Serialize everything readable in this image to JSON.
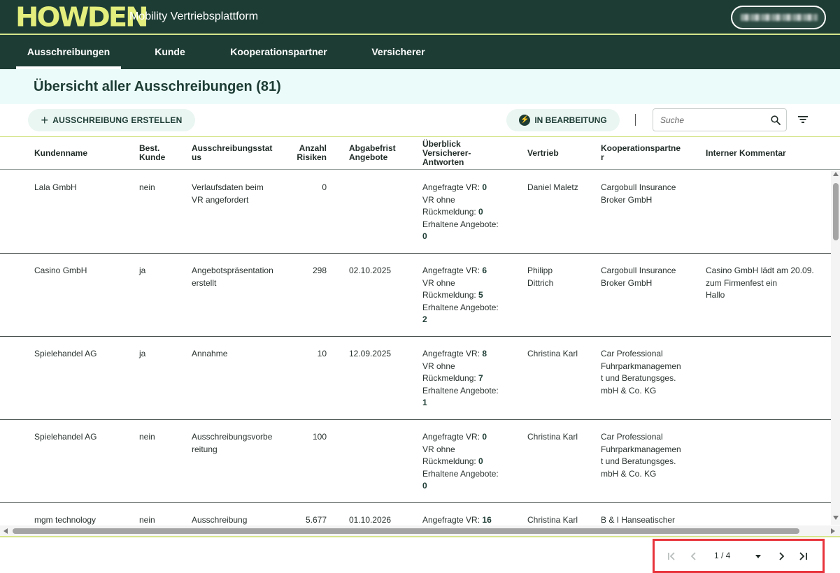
{
  "header": {
    "logo_text": "HOWDEN",
    "app_title": "Mobility Vertriebsplattform",
    "user_name": ""
  },
  "nav": {
    "items": [
      {
        "label": "Ausschreibungen",
        "active": true
      },
      {
        "label": "Kunde"
      },
      {
        "label": "Kooperationspartner"
      },
      {
        "label": "Versicherer"
      }
    ]
  },
  "page": {
    "title": "Übersicht aller Ausschreibungen (81)"
  },
  "toolbar": {
    "create_label": "AUSSCHREIBUNG ERSTELLEN",
    "status_label": "IN BEARBEITUNG",
    "search_placeholder": "Suche",
    "search_value": ""
  },
  "table": {
    "columns": [
      "Kundenname",
      "Best.\nKunde",
      "Ausschreibungsstat\nus",
      "Anzahl\nRisiken",
      "Abgabefrist\nAngebote",
      "Überblick\nVersicherer-\nAntworten",
      "Vertrieb",
      "Kooperationspartne\nr",
      "Interner Kommentar"
    ],
    "overview_labels": {
      "requested": "Angefragte VR:",
      "no_reply_1": "VR ohne",
      "no_reply_2": "Rückmeldung:",
      "offers": "Erhaltene Angebote:"
    },
    "rows": [
      {
        "kunde": "Lala GmbH",
        "best": "nein",
        "status": "Verlaufsdaten beim\nVR angefordert",
        "risiken": "0",
        "frist": "",
        "requested": "0",
        "no_reply": "0",
        "offers": "0",
        "vertrieb": "Daniel Maletz",
        "partner": "Cargobull Insurance\nBroker GmbH",
        "kommentar": ""
      },
      {
        "kunde": "Casino GmbH",
        "best": "ja",
        "status": "Angebotspräsentation\nerstellt",
        "risiken": "298",
        "frist": "02.10.2025",
        "requested": "6",
        "no_reply": "5",
        "offers": "2",
        "vertrieb": "Philipp\nDittrich",
        "partner": "Cargobull Insurance\nBroker GmbH",
        "kommentar": "Casino GmbH lädt am 20.09.\nzum Firmenfest ein\nHallo"
      },
      {
        "kunde": "Spielehandel AG",
        "best": "ja",
        "status": "Annahme",
        "risiken": "10",
        "frist": "12.09.2025",
        "requested": "8",
        "no_reply": "7",
        "offers": "1",
        "vertrieb": "Christina Karl",
        "partner": "Car Professional\nFuhrparkmanagemen\nt und Beratungsges.\nmbH & Co. KG",
        "kommentar": ""
      },
      {
        "kunde": "Spielehandel AG",
        "best": "nein",
        "status": "Ausschreibungsvorbe\nreitung",
        "risiken": "100",
        "frist": "",
        "requested": "0",
        "no_reply": "0",
        "offers": "0",
        "vertrieb": "Christina Karl",
        "partner": "Car Professional\nFuhrparkmanagemen\nt und Beratungsges.\nmbH & Co. KG",
        "kommentar": ""
      },
      {
        "kunde": "mgm technology",
        "best": "nein",
        "status": "Ausschreibung",
        "risiken": "5.677",
        "frist": "01.10.2026",
        "requested": "16",
        "no_reply": "",
        "offers": "",
        "vertrieb": "Christina Karl",
        "partner": "B & I Hanseatischer",
        "kommentar": ""
      }
    ]
  },
  "pagination": {
    "label": "1 / 4"
  },
  "colors": {
    "primary": "#1d3c34",
    "accent": "#e3ee7c",
    "band": "#ebfbf9",
    "highlight": "#e8343c"
  }
}
